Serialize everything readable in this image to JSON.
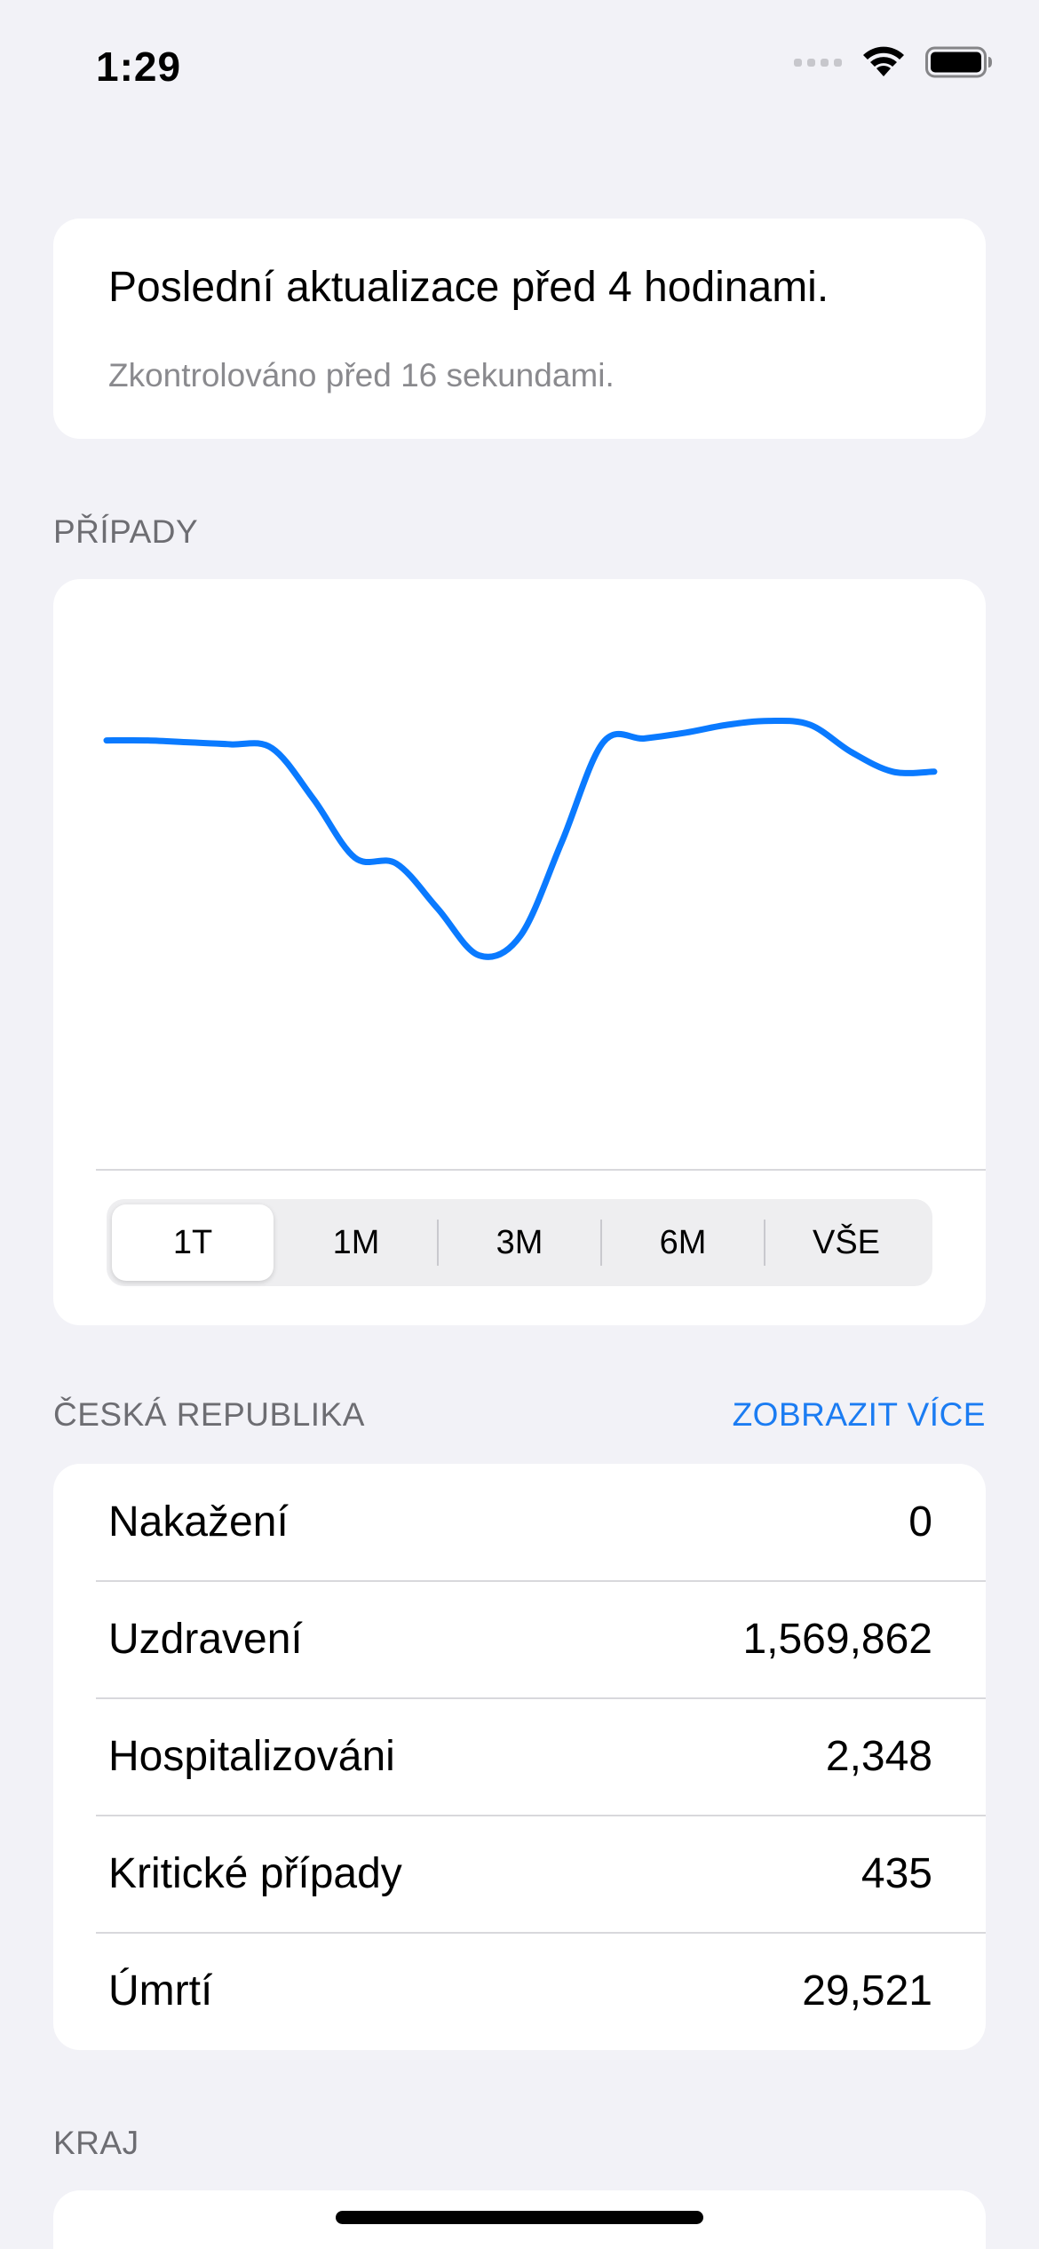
{
  "status_bar": {
    "time": "1:29",
    "icons": [
      "signal-icon",
      "wifi-icon",
      "battery-icon"
    ]
  },
  "update": {
    "title": "Poslední aktualizace před 4 hodinami.",
    "subtitle": "Zkontrolováno před 16 sekundami."
  },
  "cases_section": {
    "header": "PŘÍPADY"
  },
  "chart_data": {
    "type": "line",
    "title": "",
    "xlabel": "",
    "ylabel": "",
    "grid": false,
    "color": "#0a7aff",
    "x": [
      0,
      1,
      2,
      3,
      4,
      5,
      6,
      7,
      8,
      9,
      10,
      11,
      12,
      13,
      14,
      15,
      16,
      17,
      18,
      19,
      20
    ],
    "values": [
      0.86,
      0.86,
      0.855,
      0.85,
      0.84,
      0.71,
      0.56,
      0.545,
      0.43,
      0.31,
      0.36,
      0.6,
      0.855,
      0.865,
      0.88,
      0.9,
      0.91,
      0.9,
      0.83,
      0.78,
      0.78
    ],
    "ylim": [
      0,
      1
    ]
  },
  "range_tabs": {
    "items": [
      "1T",
      "1M",
      "3M",
      "6M",
      "VŠE"
    ],
    "selected": "1T"
  },
  "country_section": {
    "header": "ČESKÁ REPUBLIKA",
    "link": "ZOBRAZIT VÍCE"
  },
  "stats": [
    {
      "label": "Nakažení",
      "value": "0"
    },
    {
      "label": "Uzdravení",
      "value": "1,569,862"
    },
    {
      "label": "Hospitalizováni",
      "value": "2,348"
    },
    {
      "label": "Kritické případy",
      "value": "435"
    },
    {
      "label": "Úmrtí",
      "value": "29,521"
    }
  ],
  "region_section": {
    "header": "KRAJ"
  },
  "colors": {
    "accent": "#1b7cf2",
    "line": "#0a7aff",
    "background": "#f2f2f7"
  }
}
